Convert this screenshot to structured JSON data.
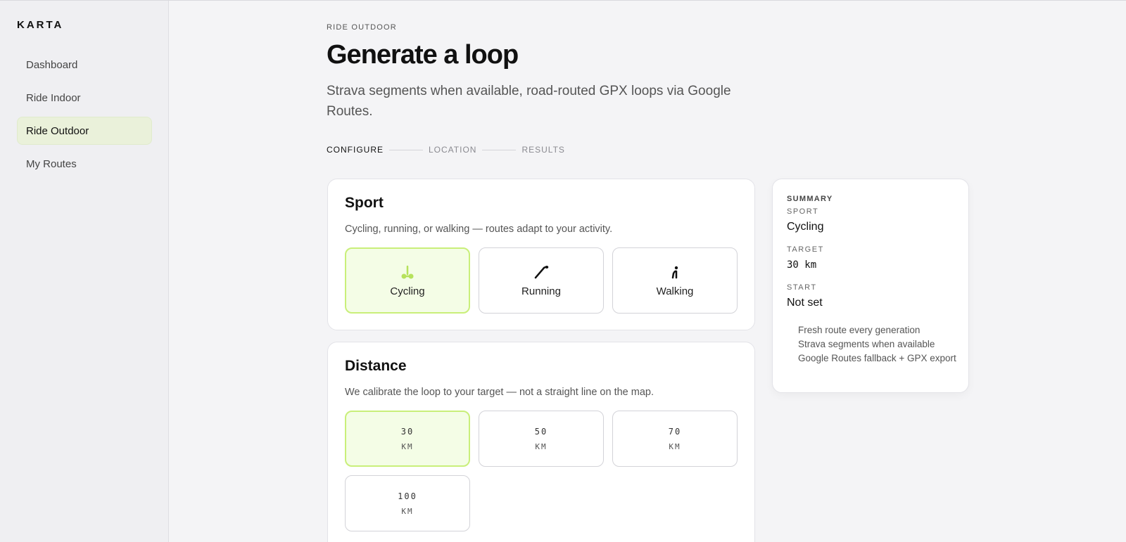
{
  "brand": "KARTA",
  "nav": [
    {
      "label": "Dashboard"
    },
    {
      "label": "Ride Indoor"
    },
    {
      "label": "Ride Outdoor"
    },
    {
      "label": "My Routes"
    }
  ],
  "header": {
    "eyebrow": "RIDE OUTDOOR",
    "title": "Generate a loop",
    "subtitle": "Strava segments when available, road-routed GPX loops via Google Routes."
  },
  "steps": [
    "CONFIGURE",
    "LOCATION",
    "RESULTS"
  ],
  "sport": {
    "title": "Sport",
    "description": "Cycling, running, or walking — routes adapt to your activity.",
    "options": [
      {
        "label": "Cycling",
        "icon": "cycling-icon"
      },
      {
        "label": "Running",
        "icon": "running-icon"
      },
      {
        "label": "Walking",
        "icon": "walking-icon"
      }
    ],
    "selected": "Cycling"
  },
  "distance": {
    "title": "Distance",
    "description": "We calibrate the loop to your target — not a straight line on the map.",
    "options": [
      {
        "value": "30",
        "unit": "KM"
      },
      {
        "value": "50",
        "unit": "KM"
      },
      {
        "value": "70",
        "unit": "KM"
      },
      {
        "value": "100",
        "unit": "KM"
      }
    ],
    "selected": "30"
  },
  "summary": {
    "heading": "SUMMARY",
    "sport_label": "SPORT",
    "sport_value": "Cycling",
    "target_label": "TARGET",
    "target_value": "30 km",
    "start_label": "START",
    "start_value": "Not set",
    "features": [
      "Fresh route every generation",
      "Strava segments when available",
      "Google Routes fallback + GPX export"
    ]
  },
  "colors": {
    "accent": "#c9ef7a",
    "accent_fill": "#f4fde6",
    "nav_active_bg": "#eaf1da"
  }
}
